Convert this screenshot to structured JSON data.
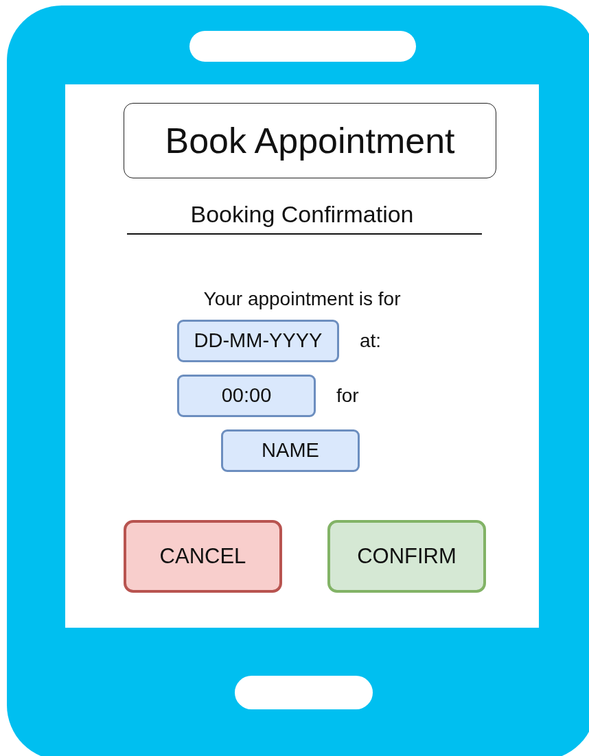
{
  "title": "Book Appointment",
  "subtitle": "Booking Confirmation",
  "message": "Your appointment is for",
  "fields": [
    {
      "value": "DD-MM-YYYY",
      "suffix": "at:"
    },
    {
      "value": "00:00",
      "suffix": "for"
    },
    {
      "value": "NAME"
    }
  ],
  "buttons": [
    {
      "label": "CANCEL",
      "kind": "cancel"
    },
    {
      "label": "CONFIRM",
      "kind": "confirm"
    }
  ]
}
